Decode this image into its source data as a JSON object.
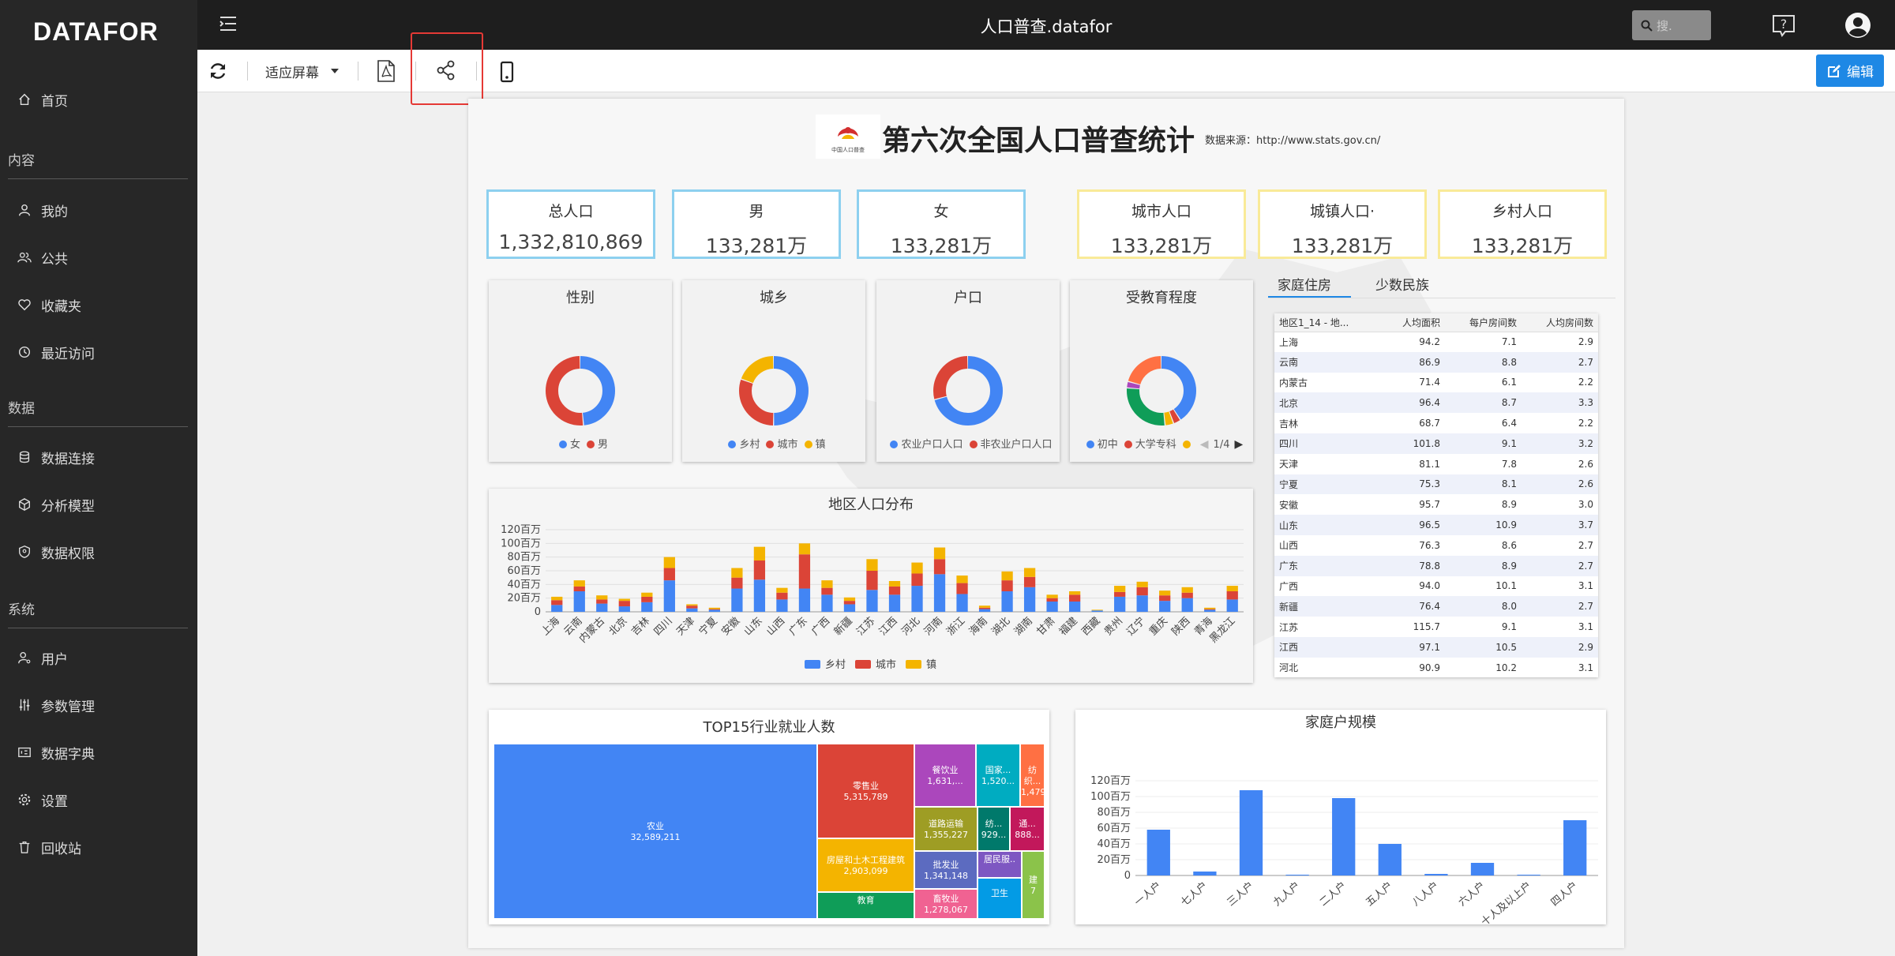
{
  "app": {
    "logo": "DATAFOR",
    "title": "人口普查.datafor",
    "search_placeholder": "搜."
  },
  "sidebar": {
    "home": "首页",
    "section_content": "内容",
    "mine": "我的",
    "public": "公共",
    "favorites": "收藏夹",
    "recent": "最近访问",
    "section_data": "数据",
    "data_connect": "数据连接",
    "analysis_model": "分析模型",
    "data_permission": "数据权限",
    "section_system": "系统",
    "users": "用户",
    "params": "参数管理",
    "dictionary": "数据字典",
    "settings": "设置",
    "recycle": "回收站"
  },
  "toolbar": {
    "fit_label": "适应屏幕",
    "edit_label": "编辑"
  },
  "report": {
    "title": "第六次全国人口普查统计",
    "source": "数据来源：http://www.stats.gov.cn/",
    "logo_text": "中国人口普查"
  },
  "kpis": [
    {
      "label": "总人口",
      "value": "1,332,810,869",
      "color": "#8dd0ef"
    },
    {
      "label": "男",
      "value": "133,281万",
      "color": "#8dd0ef"
    },
    {
      "label": "女",
      "value": "133,281万",
      "color": "#8dd0ef"
    },
    {
      "label": "城市人口",
      "value": "133,281万",
      "color": "#f9ea98"
    },
    {
      "label": "城镇人口·",
      "value": "133,281万",
      "color": "#f9ea98"
    },
    {
      "label": "乡村人口",
      "value": "133,281万",
      "color": "#f9ea98"
    }
  ],
  "donuts": [
    {
      "title": "性别",
      "legend": [
        "女",
        "男"
      ],
      "pager": ""
    },
    {
      "title": "城乡",
      "legend": [
        "乡村",
        "城市",
        "镇"
      ],
      "pager": ""
    },
    {
      "title": "户口",
      "legend": [
        "农业户口人口",
        "非农业户口人口"
      ],
      "pager": ""
    },
    {
      "title": "受教育程度",
      "legend": [
        "初中",
        "大学专科",
        ""
      ],
      "pager": "1/4"
    }
  ],
  "tabs": {
    "housing": "家庭住房",
    "minority": "少数民族"
  },
  "table": {
    "headers": [
      "地区1_14 - 地...",
      "人均面积",
      "每户房间数",
      "人均房间数"
    ],
    "rows": [
      [
        "上海",
        "94.2",
        "7.1",
        "2.9"
      ],
      [
        "云南",
        "86.9",
        "8.8",
        "2.7"
      ],
      [
        "内蒙古",
        "71.4",
        "6.1",
        "2.2"
      ],
      [
        "北京",
        "96.4",
        "8.7",
        "3.3"
      ],
      [
        "吉林",
        "68.7",
        "6.4",
        "2.2"
      ],
      [
        "四川",
        "101.8",
        "9.1",
        "3.2"
      ],
      [
        "天津",
        "81.1",
        "7.8",
        "2.6"
      ],
      [
        "宁夏",
        "75.3",
        "8.1",
        "2.6"
      ],
      [
        "安徽",
        "95.7",
        "8.9",
        "3.0"
      ],
      [
        "山东",
        "96.5",
        "10.9",
        "3.7"
      ],
      [
        "山西",
        "76.3",
        "8.6",
        "2.7"
      ],
      [
        "广东",
        "78.8",
        "8.9",
        "2.7"
      ],
      [
        "广西",
        "94.0",
        "10.1",
        "3.1"
      ],
      [
        "新疆",
        "76.4",
        "8.0",
        "2.7"
      ],
      [
        "江苏",
        "115.7",
        "9.1",
        "3.1"
      ],
      [
        "江西",
        "97.1",
        "10.5",
        "2.9"
      ],
      [
        "河北",
        "90.9",
        "10.2",
        "3.1"
      ]
    ]
  },
  "treemap": {
    "title": "TOP15行业就业人数",
    "cells": [
      {
        "label": "农业",
        "value": "32,589,211",
        "color": "#4285f4"
      },
      {
        "label": "零售业",
        "value": "5,315,789",
        "color": "#db4437"
      },
      {
        "label": "房屋和土木工程建筑",
        "value": "2,903,099",
        "color": "#f4b400"
      },
      {
        "label": "教育",
        "value": "",
        "color": "#0f9d58"
      },
      {
        "label": "餐饮业",
        "value": "1,631,...",
        "color": "#ab47bc"
      },
      {
        "label": "国家...",
        "value": "1,520...",
        "color": "#00acc1"
      },
      {
        "label": "纺织...",
        "value": "1,479...",
        "color": "#ff7043"
      },
      {
        "label": "道路运输",
        "value": "1,355,227",
        "color": "#9e9d24"
      },
      {
        "label": "纺...",
        "value": "929...",
        "color": "#00796b"
      },
      {
        "label": "通...",
        "value": "888...",
        "color": "#c2185b"
      },
      {
        "label": "批发业",
        "value": "1,341,148",
        "color": "#5c6bc0"
      },
      {
        "label": "居民服..",
        "value": "",
        "color": "#7e57c2"
      },
      {
        "label": "畜牧业",
        "value": "1,278,067",
        "color": "#f06292"
      },
      {
        "label": "卫生",
        "value": "",
        "color": "#039be5"
      },
      {
        "label": "建",
        "value": "7",
        "color": "#8bc34a"
      }
    ]
  },
  "chart_data": [
    {
      "type": "donut",
      "title": "性别",
      "categories": [
        "女",
        "男"
      ],
      "values": [
        48.7,
        51.3
      ],
      "colors": [
        "#4285f4",
        "#db4437"
      ]
    },
    {
      "type": "donut",
      "title": "城乡",
      "categories": [
        "乡村",
        "城市",
        "镇"
      ],
      "values": [
        50.3,
        30.3,
        19.4
      ],
      "colors": [
        "#4285f4",
        "#db4437",
        "#f4b400"
      ]
    },
    {
      "type": "donut",
      "title": "户口",
      "categories": [
        "农业户口人口",
        "非农业户口人口"
      ],
      "values": [
        71,
        29
      ],
      "colors": [
        "#4285f4",
        "#db4437"
      ]
    },
    {
      "type": "donut",
      "title": "受教育程度",
      "categories": [
        "初中",
        "大学专科",
        "",
        "",
        "",
        ""
      ],
      "values": [
        41,
        3.5,
        4,
        28,
        3,
        20.5
      ],
      "colors": [
        "#4285f4",
        "#db4437",
        "#f4b400",
        "#0f9d58",
        "#ab47bc",
        "#ff7043"
      ]
    },
    {
      "type": "bar",
      "stacked": true,
      "title": "地区人口分布",
      "ylim": [
        0,
        120
      ],
      "yticks": [
        "0",
        "20百万",
        "40百万",
        "60百万",
        "80百万",
        "100百万",
        "120百万"
      ],
      "categories": [
        "上海",
        "云南",
        "内蒙古",
        "北京",
        "吉林",
        "四川",
        "天津",
        "宁夏",
        "安徽",
        "山东",
        "山西",
        "广东",
        "广西",
        "新疆",
        "江苏",
        "江西",
        "河北",
        "河南",
        "浙江",
        "海南",
        "湖北",
        "湖南",
        "甘肃",
        "福建",
        "西藏",
        "贵州",
        "辽宁",
        "重庆",
        "陕西",
        "青海",
        "黑龙江"
      ],
      "series": [
        {
          "name": "乡村",
          "color": "#4285f4",
          "values": [
            10,
            30,
            12,
            8,
            14,
            46,
            5,
            3,
            34,
            47,
            18,
            34,
            25,
            11,
            32,
            25,
            38,
            55,
            26,
            4,
            30,
            36,
            15,
            15,
            2,
            22,
            24,
            16,
            20,
            3,
            18
          ]
        },
        {
          "name": "城市",
          "color": "#db4437",
          "values": [
            7,
            7,
            6,
            8,
            8,
            18,
            4,
            1,
            16,
            28,
            10,
            50,
            10,
            5,
            28,
            12,
            18,
            22,
            16,
            2,
            16,
            15,
            5,
            10,
            0,
            7,
            12,
            8,
            8,
            1,
            12
          ]
        },
        {
          "name": "镇",
          "color": "#f4b400",
          "values": [
            5,
            9,
            6,
            3,
            6,
            16,
            2,
            2,
            14,
            20,
            7,
            16,
            11,
            5,
            17,
            8,
            16,
            17,
            11,
            3,
            13,
            13,
            5,
            5,
            1,
            9,
            8,
            7,
            8,
            2,
            8
          ]
        }
      ]
    },
    {
      "type": "bar",
      "title": "家庭户规模",
      "ylim": [
        0,
        120
      ],
      "yticks": [
        "0",
        "20百万",
        "40百万",
        "60百万",
        "80百万",
        "100百万",
        "120百万"
      ],
      "categories": [
        "一人户",
        "七人户",
        "三人户",
        "九人户",
        "二人户",
        "五人户",
        "八人户",
        "六人户",
        "十人及以上户",
        "四人户"
      ],
      "values": [
        58,
        5,
        108,
        1,
        98,
        40,
        2,
        16,
        1,
        70
      ],
      "color": "#4285f4"
    }
  ]
}
